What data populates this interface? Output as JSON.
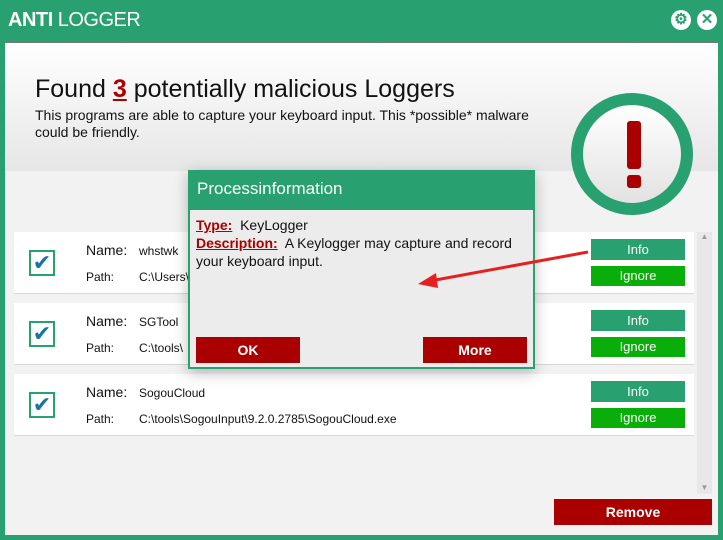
{
  "titlebar": {
    "title_bold": "ANTI",
    "title_rest": "LOGGER",
    "settings_icon": "gear-icon",
    "close_icon": "close-icon"
  },
  "header": {
    "found_prefix": "Found",
    "count": "3",
    "found_suffix": "potentially malicious Loggers",
    "subtitle": "This programs are able to capture your keyboard input. This *possible* malware could be friendly.",
    "alert_icon": "exclamation-icon"
  },
  "labels": {
    "name": "Name:",
    "path": "Path:",
    "info": "Info",
    "ignore": "Ignore"
  },
  "items": [
    {
      "name": "whstwk",
      "path": "C:\\Users\\",
      "checked": true
    },
    {
      "name": "SGTool",
      "path": "C:\\tools\\",
      "checked": true
    },
    {
      "name": "SogouCloud",
      "path": "C:\\tools\\SogouInput\\9.2.0.2785\\SogouCloud.exe",
      "checked": true
    }
  ],
  "remove_label": "Remove",
  "dialog": {
    "title": "Processinformation",
    "type_label": "Type:",
    "type_value": "KeyLogger",
    "desc_label": "Description:",
    "desc_value": "A Keylogger may capture and record your keyboard input.",
    "ok": "OK",
    "more": "More"
  },
  "colors": {
    "brand": "#28a070",
    "danger": "#aa0000",
    "ignore": "#0aae0a"
  }
}
